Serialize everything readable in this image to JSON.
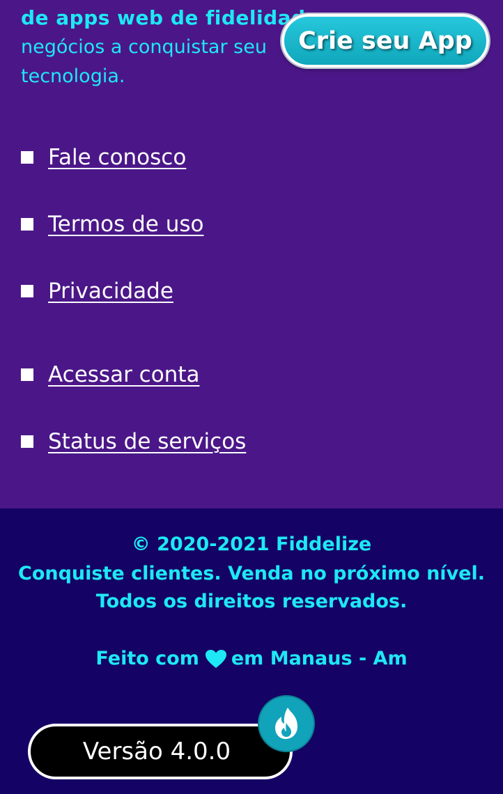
{
  "intro": {
    "bold_line": "de apps web de fidelidade",
    "line1": "negócios a conquistar seu",
    "line2": "tecnologia."
  },
  "cta": {
    "label": "Crie seu App"
  },
  "nav": {
    "items": [
      {
        "label": "Fale conosco"
      },
      {
        "label": "Termos de uso"
      },
      {
        "label": "Privacidade"
      },
      {
        "label": "Acessar conta"
      },
      {
        "label": "Status de serviços"
      }
    ]
  },
  "footer": {
    "copyright": "© 2020-2021 Fiddelize",
    "tagline": "Conquiste clientes. Venda no próximo nível.",
    "rights": "Todos os direitos reservados.",
    "made_prefix": "Feito com",
    "made_suffix": "em Manaus - Am",
    "version": "Versão 4.0.0"
  },
  "icons": {
    "bullet": "square-bullet-icon",
    "heart": "heart-icon",
    "flame": "flame-icon"
  },
  "colors": {
    "purple_bg": "#4b1788",
    "footer_bg": "#140365",
    "cyan_text": "#1ee8f5",
    "cta_bg": "#16b3c8",
    "flame_badge": "#11a3b9"
  }
}
